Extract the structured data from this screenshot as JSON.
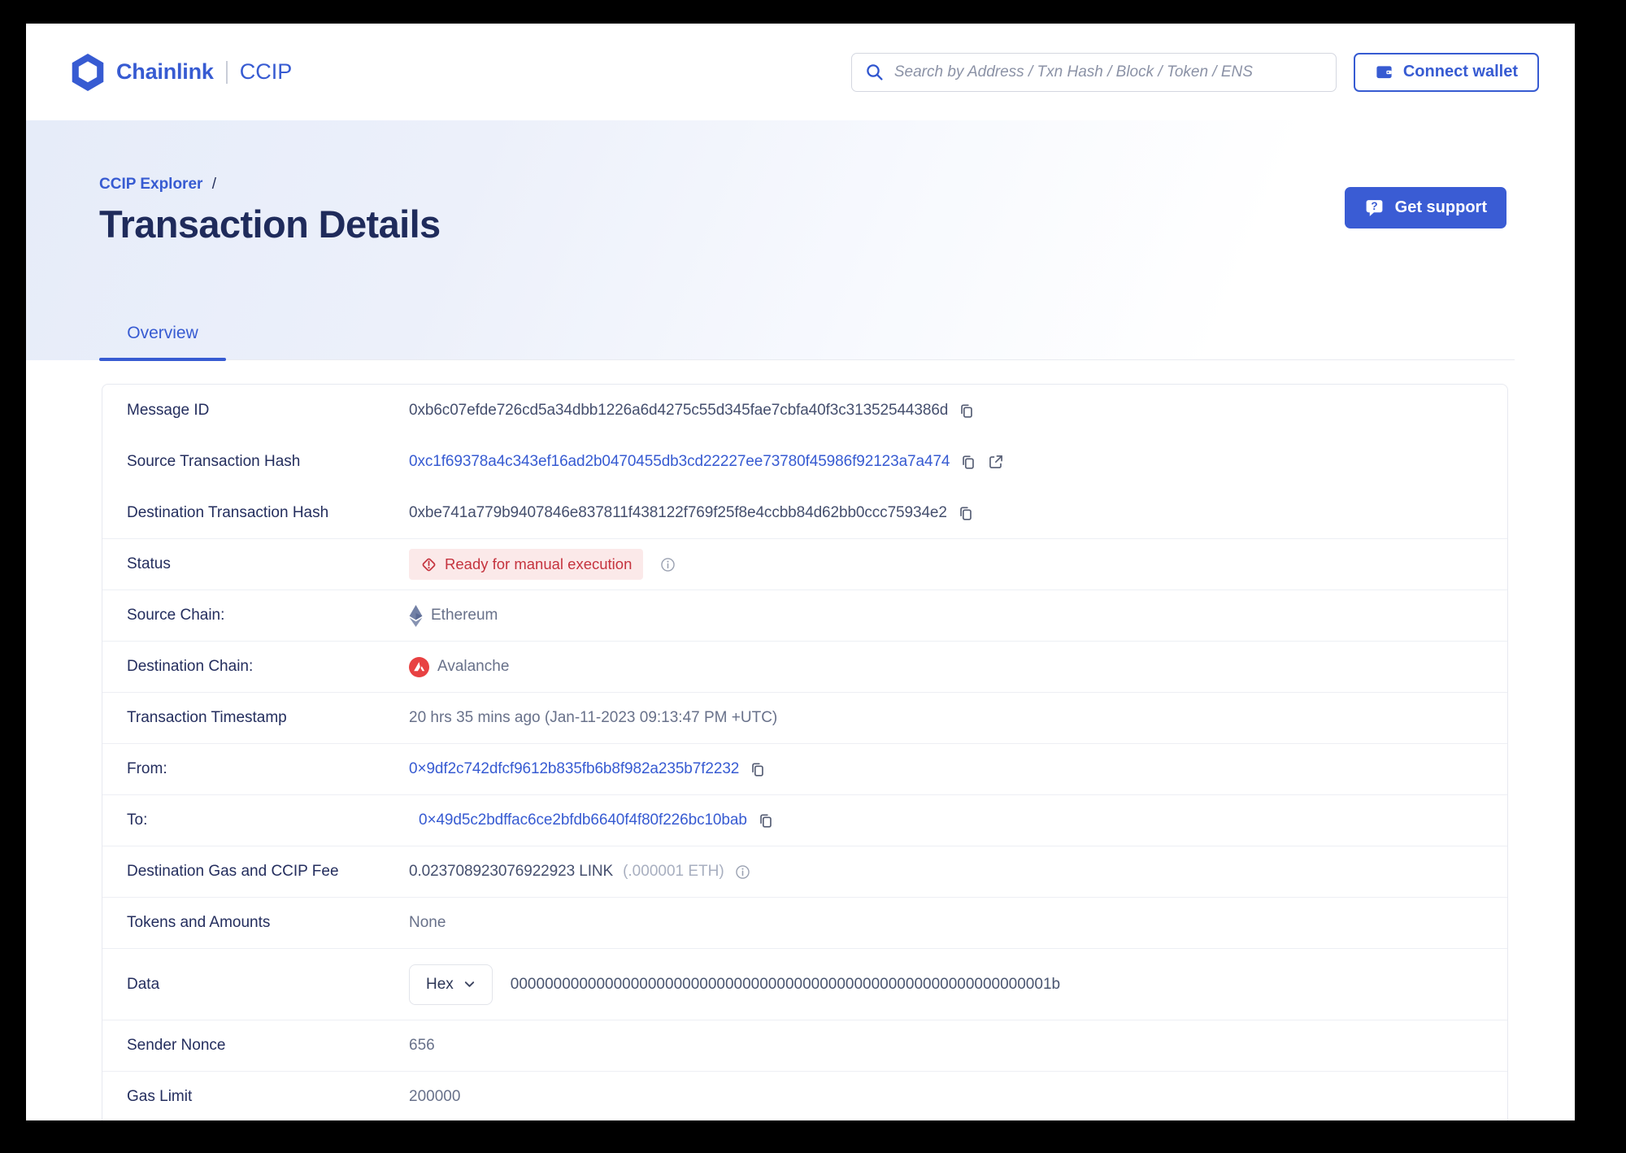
{
  "colors": {
    "accent_blue": "#375bd2",
    "status_red": "#c5333e",
    "status_red_bg": "#fbe9e9",
    "avalanche_red": "#e84142",
    "ethereum_slate": "#7280a5"
  },
  "header": {
    "brand": "Chainlink",
    "product": "CCIP",
    "search": {
      "placeholder": "Search by Address / Txn Hash / Block / Token / ENS"
    },
    "connect_wallet": "Connect wallet"
  },
  "hero": {
    "breadcrumb": "CCIP Explorer",
    "separator": "/",
    "title": "Transaction Details",
    "get_support": "Get support"
  },
  "tabs": {
    "overview": "Overview"
  },
  "rows": {
    "message_id": {
      "label": "Message ID",
      "value": "0xb6c07efde726cd5a34dbb1226a6d4275c55d345fae7cbfa40f3c31352544386d"
    },
    "source_tx": {
      "label": "Source Transaction Hash",
      "value": "0xc1f69378a4c343ef16ad2b0470455db3cd22227ee73780f45986f92123a7a474"
    },
    "dest_tx": {
      "label": "Destination Transaction Hash",
      "value": "0xbe741a779b9407846e837811f438122f769f25f8e4ccbb84d62bb0ccc75934e2"
    },
    "status": {
      "label": "Status",
      "badge": "Ready for manual execution"
    },
    "source_chain": {
      "label": "Source Chain:",
      "value": "Ethereum"
    },
    "dest_chain": {
      "label": "Destination Chain:",
      "value": "Avalanche"
    },
    "timestamp": {
      "label": "Transaction Timestamp",
      "value": "20 hrs 35 mins ago (Jan-11-2023 09:13:47 PM +UTC)"
    },
    "from": {
      "label": "From:",
      "value": "0×9df2c742dfcf9612b835fb6b8f982a235b7f2232"
    },
    "to": {
      "label": "To:",
      "value": "0×49d5c2bdffac6ce2bfdb6640f4f80f226bc10bab"
    },
    "fee": {
      "label": "Destination Gas and CCIP Fee",
      "value": "0.023708923076922923 LINK",
      "secondary": "(.000001 ETH)"
    },
    "tokens": {
      "label": "Tokens and Amounts",
      "value": "None"
    },
    "data": {
      "label": "Data",
      "format": "Hex",
      "value": "000000000000000000000000000000000000000000000000000000000000001b"
    },
    "sender_nonce": {
      "label": "Sender Nonce",
      "value": "656"
    },
    "gas_limit": {
      "label": "Gas Limit",
      "value": "200000"
    }
  }
}
